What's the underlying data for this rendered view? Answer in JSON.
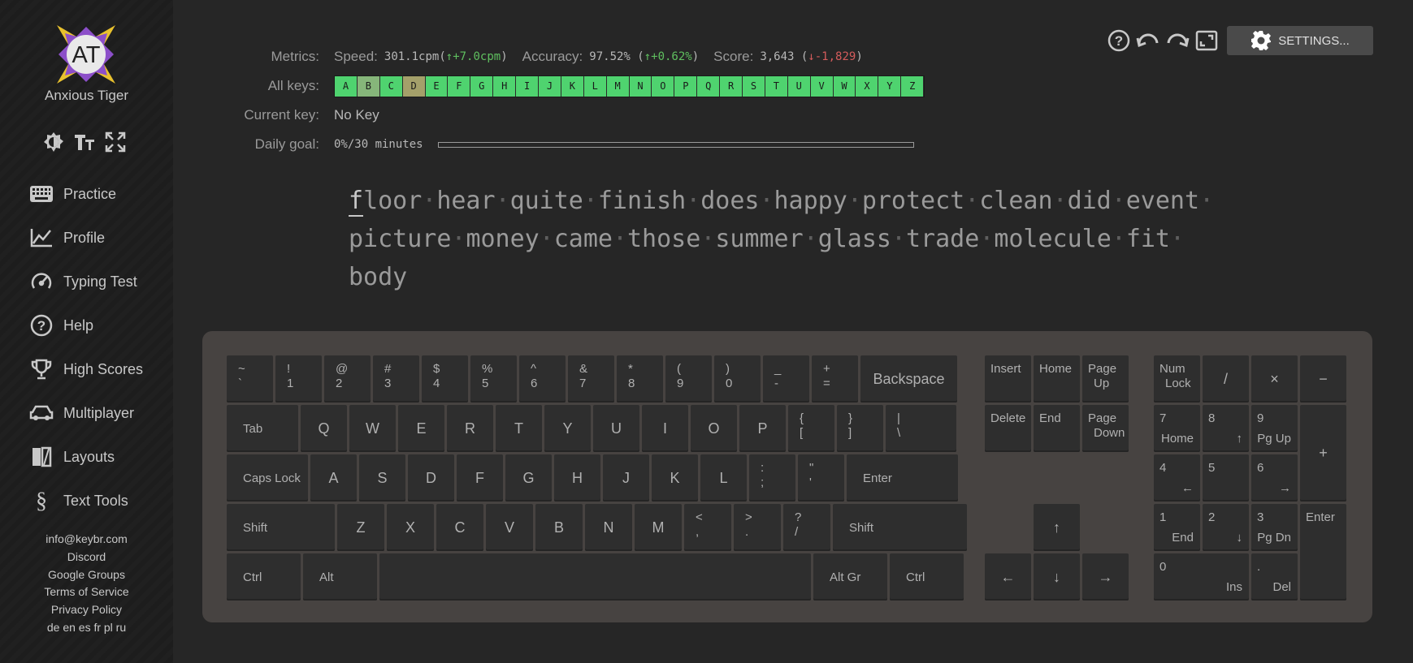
{
  "user": {
    "initials": "AT",
    "name": "Anxious Tiger"
  },
  "tool_icons": [
    "theme-icon",
    "font-size-icon",
    "fullscreen-icon"
  ],
  "nav": [
    {
      "label": "Practice",
      "icon": "keyboard-icon"
    },
    {
      "label": "Profile",
      "icon": "chart-icon"
    },
    {
      "label": "Typing Test",
      "icon": "speedometer-icon"
    },
    {
      "label": "Help",
      "icon": "help-icon"
    },
    {
      "label": "High Scores",
      "icon": "trophy-icon"
    },
    {
      "label": "Multiplayer",
      "icon": "car-icon"
    },
    {
      "label": "Layouts",
      "icon": "layouts-icon"
    },
    {
      "label": "Text Tools",
      "icon": "section-icon"
    }
  ],
  "footer": {
    "email": "info@keybr.com",
    "discord": "Discord",
    "groups": "Google Groups",
    "terms": "Terms of Service",
    "privacy": "Privacy Policy",
    "languages": "de en es fr pl ru"
  },
  "topbar": {
    "settings_label": "SETTINGS..."
  },
  "metrics": {
    "metrics_label": "Metrics:",
    "speed_label": "Speed:",
    "speed_value": "301.1cpm",
    "speed_delta": "↑+7.0cpm",
    "accuracy_label": "Accuracy:",
    "accuracy_value": "97.52%",
    "accuracy_delta": "↑+0.62%",
    "score_label": "Score:",
    "score_value": "3,643",
    "score_delta": "↓-1,829",
    "all_keys_label": "All keys:",
    "keys": [
      "A",
      "B",
      "C",
      "D",
      "E",
      "F",
      "G",
      "H",
      "I",
      "J",
      "K",
      "L",
      "M",
      "N",
      "O",
      "P",
      "Q",
      "R",
      "S",
      "T",
      "U",
      "V",
      "W",
      "X",
      "Y",
      "Z"
    ],
    "current_key_label": "Current key:",
    "current_key_value": "No Key",
    "daily_goal_label": "Daily goal:",
    "daily_goal_value": "0%/30 minutes",
    "daily_goal_progress": 0
  },
  "practice_text": {
    "lines": [
      [
        "floor",
        "hear",
        "quite",
        "finish",
        "does",
        "happy",
        "protect",
        "clean",
        "did",
        "event"
      ],
      [
        "picture",
        "money",
        "came",
        "those",
        "summer",
        "glass",
        "trade",
        "molecule",
        "fit"
      ],
      [
        "body"
      ]
    ]
  },
  "keyboard": {
    "row1": [
      [
        "~",
        "`"
      ],
      [
        "!",
        "1"
      ],
      [
        "@",
        "2"
      ],
      [
        "#",
        "3"
      ],
      [
        "$",
        "4"
      ],
      [
        "%",
        "5"
      ],
      [
        "^",
        "6"
      ],
      [
        "&",
        "7"
      ],
      [
        "*",
        "8"
      ],
      [
        "(",
        "9"
      ],
      [
        ")",
        "0"
      ],
      [
        "_",
        "-"
      ],
      [
        "+",
        "="
      ]
    ],
    "backspace": "Backspace",
    "tab": "Tab",
    "row2": [
      "Q",
      "W",
      "E",
      "R",
      "T",
      "Y",
      "U",
      "I",
      "O",
      "P"
    ],
    "row2_sym": [
      [
        "{",
        "["
      ],
      [
        "}",
        "]"
      ],
      [
        "|",
        "\\"
      ]
    ],
    "caps": "Caps Lock",
    "row3": [
      "A",
      "S",
      "D",
      "F",
      "G",
      "H",
      "J",
      "K",
      "L"
    ],
    "row3_sym": [
      [
        ":",
        ";"
      ],
      [
        "\"",
        "'"
      ]
    ],
    "enter": "Enter",
    "shift_left": "Shift",
    "row4": [
      "Z",
      "X",
      "C",
      "V",
      "B",
      "N",
      "M"
    ],
    "row4_sym": [
      [
        "<",
        ","
      ],
      [
        ">",
        "."
      ],
      [
        "?",
        "/"
      ]
    ],
    "shift_right": "Shift",
    "ctrl_left": "Ctrl",
    "alt": "Alt",
    "alt_gr": "Alt Gr",
    "ctrl_right": "Ctrl",
    "nav_cluster": [
      [
        "Insert"
      ],
      [
        "Home"
      ],
      [
        "Page",
        "Up"
      ],
      [
        "Delete"
      ],
      [
        "End"
      ],
      [
        "Page",
        "Down"
      ]
    ],
    "arrows": {
      "up": "↑",
      "left": "←",
      "down": "↓",
      "right": "→"
    },
    "numpad": {
      "numlock": [
        "Num",
        "Lock"
      ],
      "slash": "/",
      "times": "×",
      "minus": "−",
      "plus": "+",
      "n7": [
        "7",
        "Home"
      ],
      "n8": [
        "8",
        "↑"
      ],
      "n9": [
        "9",
        "Pg Up"
      ],
      "n4": [
        "4",
        "←"
      ],
      "n5": [
        "5"
      ],
      "n6": [
        "6",
        "→"
      ],
      "n1": [
        "1",
        "End"
      ],
      "n2": [
        "2",
        "↓"
      ],
      "n3": [
        "3",
        "Pg Dn"
      ],
      "n0": [
        "0",
        "Ins"
      ],
      "dot": [
        ".",
        "Del"
      ],
      "enter": "Enter"
    }
  },
  "colors": {
    "key_good": "#4fd36f",
    "key_b": "#86b67a",
    "key_d": "#a4a06a",
    "delta_up": "#5fbf5f",
    "delta_down": "#d35b5b"
  }
}
